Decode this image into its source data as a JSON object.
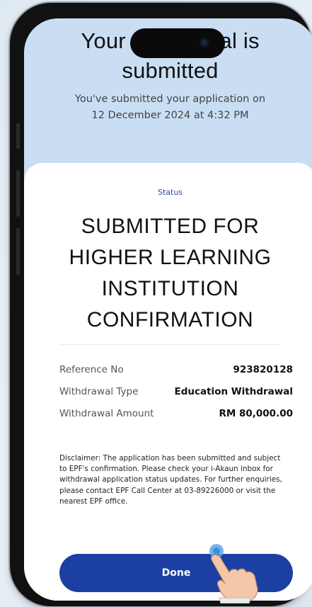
{
  "header": {
    "title_line1": "Your withdrawal is",
    "title_line2": "submitted",
    "subtitle_line1": "You've submitted your application on",
    "subtitle_line2": "12 December 2024 at 4:32 PM"
  },
  "status": {
    "label": "Status",
    "title_lines": [
      "SUBMITTED FOR",
      "HIGHER LEARNING",
      "INSTITUTION",
      "CONFIRMATION"
    ]
  },
  "details": [
    {
      "label": "Reference No",
      "value": "923820128"
    },
    {
      "label": "Withdrawal Type",
      "value": "Education Withdrawal"
    },
    {
      "label": "Withdrawal Amount",
      "value": "RM 80,000.00"
    }
  ],
  "disclaimer": "Disclaimer: The application has been submitted and subject to EPF's confirmation. Please check your i-Akaun inbox for withdrawal application status updates. For further enquiries, please contact EPF Call Center at 03-89226000 or visit the nearest EPF office.",
  "done_button": {
    "label": "Done"
  },
  "colors": {
    "primary": "#1b3fa3",
    "header_bg": "#c9def3",
    "status_label": "#2f4aa8"
  }
}
